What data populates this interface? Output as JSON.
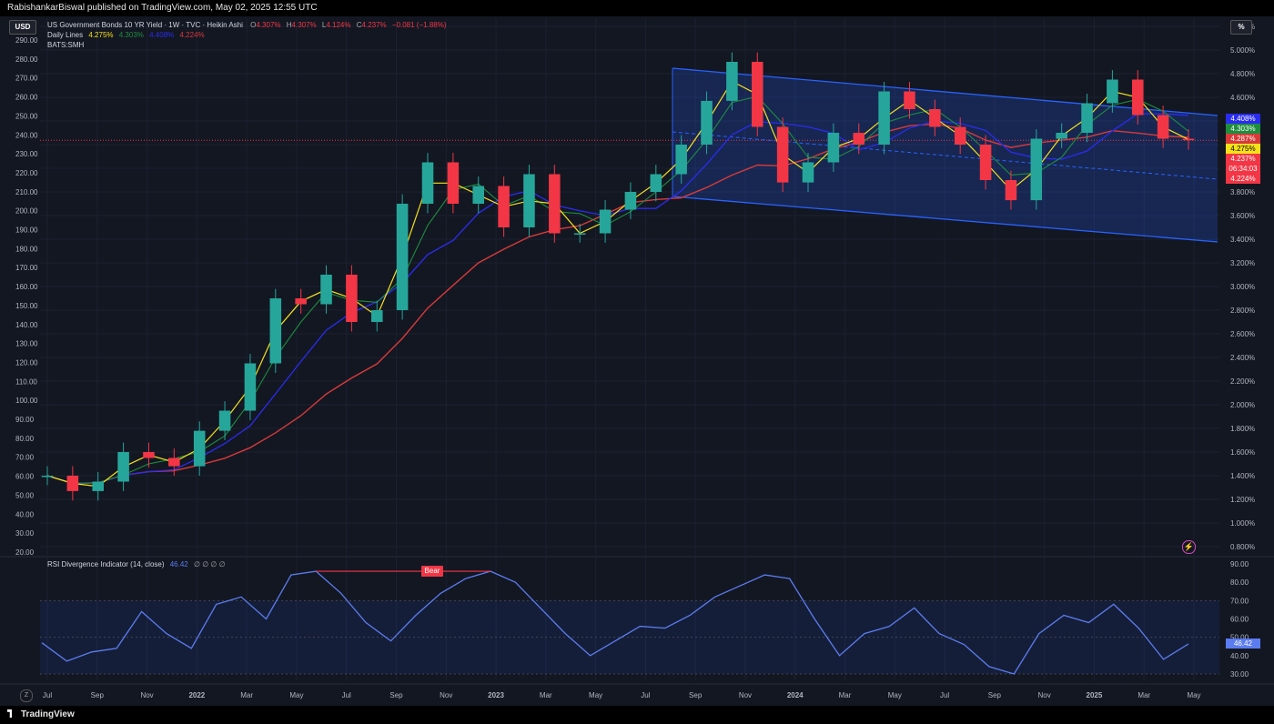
{
  "header": {
    "publisher": "RabishankarBiswal published on TradingView.com, May 02, 2025 12:55 UTC"
  },
  "currency_button": "USD",
  "scale_button": "%",
  "legend": {
    "title": "US Government Bonds 10 YR Yield · 1W · TVC · Heikin Ashi",
    "o_label": "O",
    "o_value": "4.307%",
    "h_label": "H",
    "h_value": "4.307%",
    "l_label": "L",
    "l_value": "4.124%",
    "c_label": "C",
    "c_value": "4.237%",
    "change": "−0.081 (−1.88%)",
    "daily_lines_label": "Daily Lines",
    "daily_lines_values": [
      "4.275%",
      "4.303%",
      "4.408%",
      "4.224%"
    ],
    "bats_label": "BATS:SMH"
  },
  "rsi_legend": {
    "label": "RSI Divergence Indicator (14, close)",
    "value": "46.42",
    "nulls": "∅ ∅ ∅ ∅"
  },
  "bear_label": "Bear",
  "left_axis": [
    "290.00",
    "280.00",
    "270.00",
    "260.00",
    "250.00",
    "240.00",
    "230.00",
    "220.00",
    "210.00",
    "200.00",
    "190.00",
    "180.00",
    "170.00",
    "160.00",
    "150.00",
    "140.00",
    "130.00",
    "120.00",
    "110.00",
    "100.00",
    "90.00",
    "80.00",
    "70.00",
    "60.00",
    "50.00",
    "40.00",
    "30.00",
    "20.00"
  ],
  "right_axis": [
    "5.200%",
    "5.000%",
    "4.800%",
    "4.600%",
    "4.400%",
    "4.200%",
    "4.000%",
    "3.800%",
    "3.600%",
    "3.400%",
    "3.200%",
    "3.000%",
    "2.800%",
    "2.600%",
    "2.400%",
    "2.200%",
    "2.000%",
    "1.800%",
    "1.600%",
    "1.400%",
    "1.200%",
    "1.000%",
    "0.800%"
  ],
  "rsi_axis": [
    "90.00",
    "80.00",
    "70.00",
    "60.00",
    "50.00",
    "40.00",
    "30.00"
  ],
  "rsi_badge": "46.42",
  "price_badges": [
    {
      "text": "4.408%",
      "color": "#2a2cf0"
    },
    {
      "text": "4.303%",
      "color": "#1e8e3e"
    },
    {
      "text": "4.287%",
      "color": "#d83a3a"
    },
    {
      "text": "4.275%",
      "color": "#f5e11a"
    },
    {
      "text": "4.237%",
      "color": "#f23645"
    },
    {
      "text": "06:34:03",
      "color": "#f23645"
    },
    {
      "text": "4.224%",
      "color": "#f23645"
    }
  ],
  "time_axis": [
    "Jul",
    "Sep",
    "Nov",
    "2022",
    "Mar",
    "May",
    "Jul",
    "Sep",
    "Nov",
    "2023",
    "Mar",
    "May",
    "Jul",
    "Sep",
    "Nov",
    "2024",
    "Mar",
    "May",
    "Jul",
    "Sep",
    "Nov",
    "2025",
    "Mar",
    "May"
  ],
  "footer": {
    "logo_text": "TradingView"
  },
  "colors": {
    "up": "#26a69a",
    "down": "#f23645",
    "background": "#131722",
    "channel": "#2962ff",
    "sma_short": "#f5e11a",
    "sma_mid": "#1e8e3e",
    "sma_long": "#2a2cf0",
    "sma_200": "#d83a3a",
    "rsi": "#5b7cf0"
  },
  "chart_data": {
    "type": "line",
    "title": "US Government Bonds 10 YR Yield · 1W · TVC · Heikin Ashi",
    "ylabel": "%",
    "ylim": [
      0.8,
      5.2
    ],
    "x": [
      "2021-07",
      "2021-08",
      "2021-09",
      "2021-10",
      "2021-11",
      "2021-12",
      "2022-01",
      "2022-02",
      "2022-03",
      "2022-04",
      "2022-05",
      "2022-06",
      "2022-07",
      "2022-08",
      "2022-09",
      "2022-10",
      "2022-11",
      "2022-12",
      "2023-01",
      "2023-02",
      "2023-03",
      "2023-04",
      "2023-05",
      "2023-06",
      "2023-07",
      "2023-08",
      "2023-09",
      "2023-10",
      "2023-11",
      "2023-12",
      "2024-01",
      "2024-02",
      "2024-03",
      "2024-04",
      "2024-05",
      "2024-06",
      "2024-07",
      "2024-08",
      "2024-09",
      "2024-10",
      "2024-11",
      "2024-12",
      "2025-01",
      "2025-02",
      "2025-03",
      "2025-04"
    ],
    "series": [
      {
        "name": "US Government Bonds 10 YR Yield",
        "values": [
          1.4,
          1.27,
          1.35,
          1.6,
          1.55,
          1.48,
          1.78,
          1.95,
          2.35,
          2.9,
          2.85,
          3.1,
          2.7,
          2.8,
          3.7,
          4.05,
          3.7,
          3.85,
          3.5,
          3.95,
          3.45,
          3.45,
          3.65,
          3.8,
          3.95,
          4.2,
          4.57,
          4.9,
          4.35,
          3.88,
          4.05,
          4.3,
          4.2,
          4.65,
          4.5,
          4.35,
          4.2,
          3.9,
          3.73,
          4.25,
          4.3,
          4.55,
          4.75,
          4.45,
          4.25,
          4.237
        ]
      }
    ]
  },
  "rsi_data": {
    "name": "RSI Divergence Indicator (14, close)",
    "ylim": [
      30,
      90
    ],
    "values": [
      47,
      37,
      42,
      44,
      64,
      52,
      44,
      68,
      72,
      60,
      84,
      86,
      74,
      58,
      48,
      62,
      74,
      82,
      86,
      80,
      66,
      52,
      40,
      48,
      56,
      55,
      62,
      72,
      78,
      84,
      82,
      60,
      40,
      52,
      56,
      66,
      52,
      46,
      34,
      30,
      52,
      62,
      58,
      68,
      55,
      38,
      46.42
    ]
  }
}
